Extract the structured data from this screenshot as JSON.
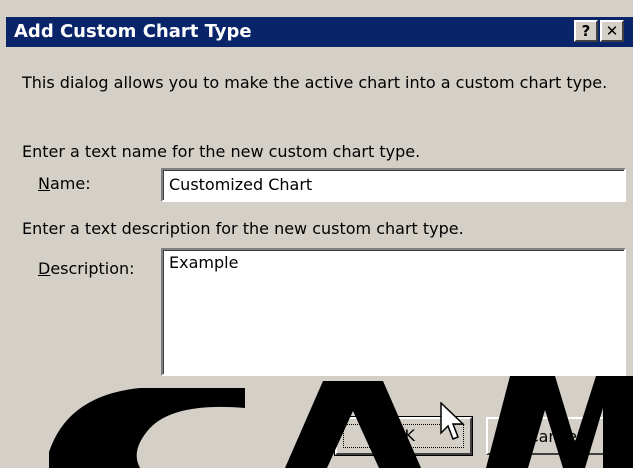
{
  "dialog": {
    "title": "Add Custom Chart Type",
    "help_button": "?",
    "close_button": "✕",
    "intro": "This dialog allows you to make the active chart into a custom chart type.",
    "name_prompt": "Enter a text name for the new custom chart type.",
    "name_label_access": "N",
    "name_label_rest": "ame:",
    "name_value": "Customized Chart",
    "description_prompt": "Enter a text description for the new custom chart type.",
    "description_label_access": "D",
    "description_label_rest": "escription:",
    "description_value": "Example",
    "ok_label": "OK",
    "cancel_label": "Cancel"
  },
  "colors": {
    "title_bar": "#0a246a",
    "face": "#d4d0c8",
    "watermark": "#000000"
  },
  "icons": [
    "help-icon",
    "close-icon",
    "arrow-cursor-icon"
  ]
}
